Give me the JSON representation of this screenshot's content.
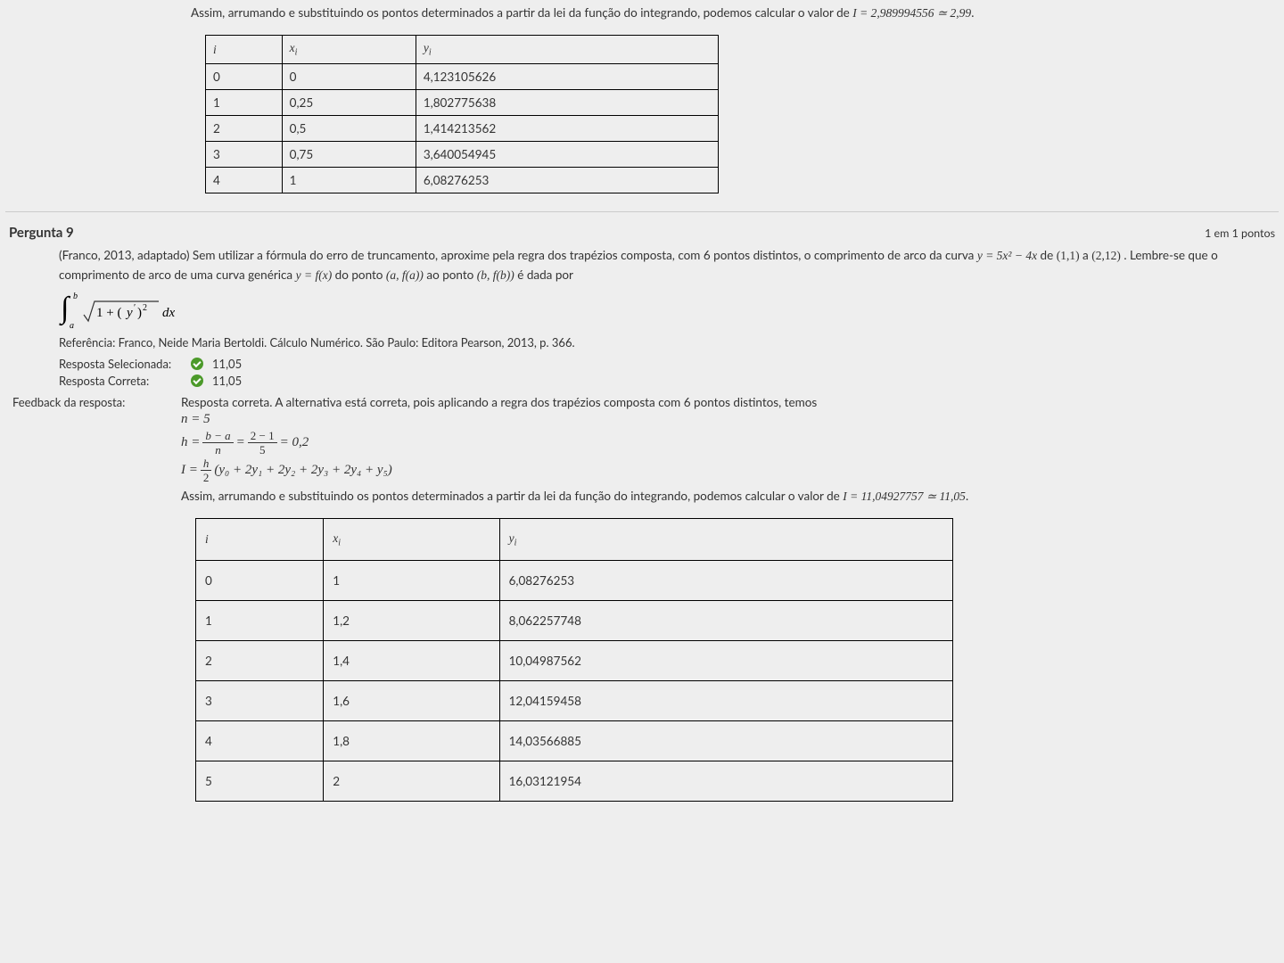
{
  "top_feedback": {
    "intro": "Assim, arrumando e substituindo os pontos determinados a partir da lei da função do integrando, podemos calcular o valor de ",
    "result_expr": "I = 2,989994556 ≃ 2,99",
    "result_suffix": "."
  },
  "table1": {
    "headers": {
      "i": "i",
      "xi_var": "x",
      "xi_sub": "i",
      "yi_var": "y",
      "yi_sub": "i"
    },
    "rows": [
      {
        "i": "0",
        "x": "0",
        "y": "4,123105626"
      },
      {
        "i": "1",
        "x": "0,25",
        "y": "1,802775638"
      },
      {
        "i": "2",
        "x": "0,5",
        "y": "1,414213562"
      },
      {
        "i": "3",
        "x": "0,75",
        "y": "3,640054945"
      },
      {
        "i": "4",
        "x": "1",
        "y": "6,08276253"
      }
    ]
  },
  "q9": {
    "title": "Pergunta 9",
    "points": "1 em 1 pontos",
    "prompt": {
      "p1_a": "(Franco, 2013, adaptado) Sem utilizar a fórmula do erro de truncamento, aproxime pela regra dos trapézios composta, com 6 pontos distintos, o comprimento de arco da curva ",
      "curve_expr": "y = 5x² − 4x",
      "p1_b": " de ",
      "pt1": "(1,1)",
      "p1_c": " a ",
      "pt2": "(2,12)",
      "p1_d": " . Lembre-se que o comprimento de arco de uma curva genérica ",
      "gen_expr": "y = f(x)",
      "p1_e": " do ponto ",
      "ptA": "(a, f(a))",
      "p1_f": " ao ponto ",
      "ptB": "(b, f(b))",
      "p1_g": " é dada por"
    },
    "integral_alt": "Integral from a to b of sqrt(1 + (y')^2) dx",
    "reference": "Referência: Franco, Neide Maria Bertoldi. Cálculo Numérico. São Paulo: Editora Pearson, 2013, p. 366.",
    "selected_label": "Resposta Selecionada:",
    "selected_value": "11,05",
    "correct_label": "Resposta Correta:",
    "correct_value": "11,05",
    "feedback_label": "Feedback da resposta:",
    "feedback": {
      "intro": "Resposta correta. A alternativa está correta, pois aplicando a regra dos trapézios composta com 6 pontos distintos, temos",
      "line_n": "n = 5",
      "h_lhs": "h =",
      "h_frac1_num": "b − a",
      "h_frac1_den": "n",
      "h_mid": "=",
      "h_frac2_num": "2 − 1",
      "h_frac2_den": "5",
      "h_rhs": "= 0,2",
      "I_lhs": "I =",
      "I_frac_num": "h",
      "I_frac_den": "2",
      "I_rhs": "(y₀ + 2y₁ + 2y₂ + 2y₃ + 2y₄ + y₅)",
      "conclusion_a": "Assim, arrumando e substituindo os pontos determinados a partir da lei da função do integrando, podemos calcular o valor de ",
      "conclusion_expr": "I = 11,04927757 ≃ 11,05",
      "conclusion_b": "."
    }
  },
  "table2": {
    "headers": {
      "i": "i",
      "xi_var": "x",
      "xi_sub": "i",
      "yi_var": "y",
      "yi_sub": "i"
    },
    "rows": [
      {
        "i": "0",
        "x": "1",
        "y": "6,08276253"
      },
      {
        "i": "1",
        "x": "1,2",
        "y": "8,062257748"
      },
      {
        "i": "2",
        "x": "1,4",
        "y": "10,04987562"
      },
      {
        "i": "3",
        "x": "1,6",
        "y": "12,04159458"
      },
      {
        "i": "4",
        "x": "1,8",
        "y": "14,03566885"
      },
      {
        "i": "5",
        "x": "2",
        "y": "16,03121954"
      }
    ]
  }
}
